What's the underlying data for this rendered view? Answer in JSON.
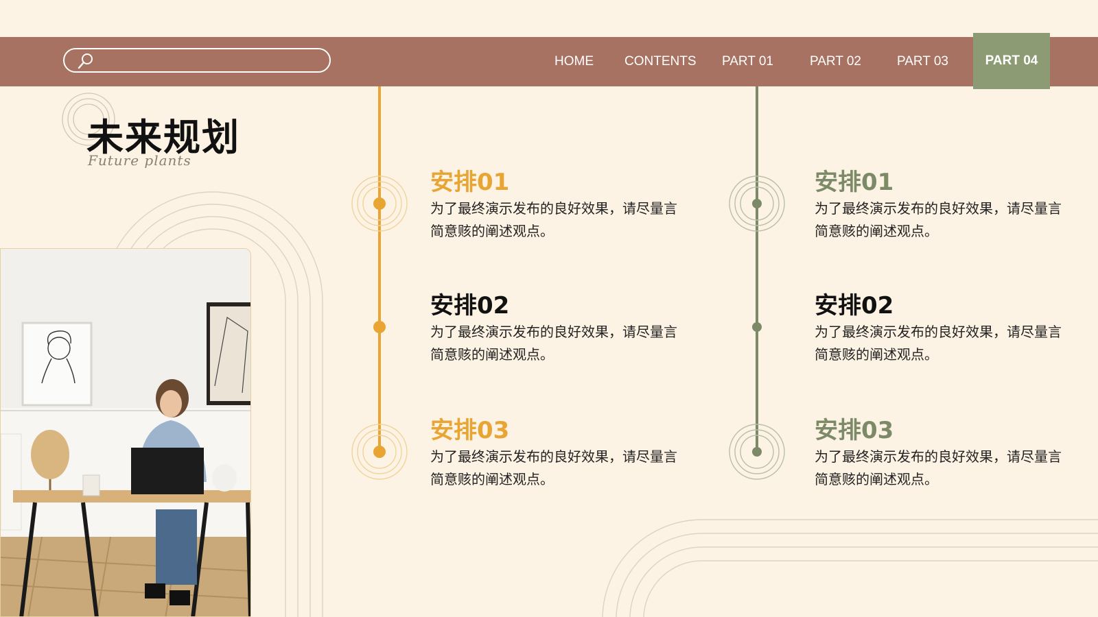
{
  "nav": {
    "items": [
      "HOME",
      "CONTENTS",
      "PART 01",
      "PART 02",
      "PART 03"
    ],
    "active": "PART 04"
  },
  "heading": {
    "title": "未来规划",
    "subtitle": "Future plants"
  },
  "colors": {
    "topbar": "#a87262",
    "active_tab": "#8c9b74",
    "accent_orange": "#e8a533",
    "accent_green": "#7d8a68",
    "background": "#fdf3e4"
  },
  "left_column": [
    {
      "title": "安排01",
      "desc": "为了最终演示发布的良好效果，请尽量言简意赅的阐述观点。"
    },
    {
      "title": "安排02",
      "desc": "为了最终演示发布的良好效果，请尽量言简意赅的阐述观点。"
    },
    {
      "title": "安排03",
      "desc": "为了最终演示发布的良好效果，请尽量言简意赅的阐述观点。"
    }
  ],
  "right_column": [
    {
      "title": "安排01",
      "desc": "为了最终演示发布的良好效果，请尽量言简意赅的阐述观点。"
    },
    {
      "title": "安排02",
      "desc": "为了最终演示发布的良好效果，请尽量言简意赅的阐述观点。"
    },
    {
      "title": "安排03",
      "desc": "为了最终演示发布的良好效果，请尽量言简意赅的阐述观点。"
    }
  ]
}
